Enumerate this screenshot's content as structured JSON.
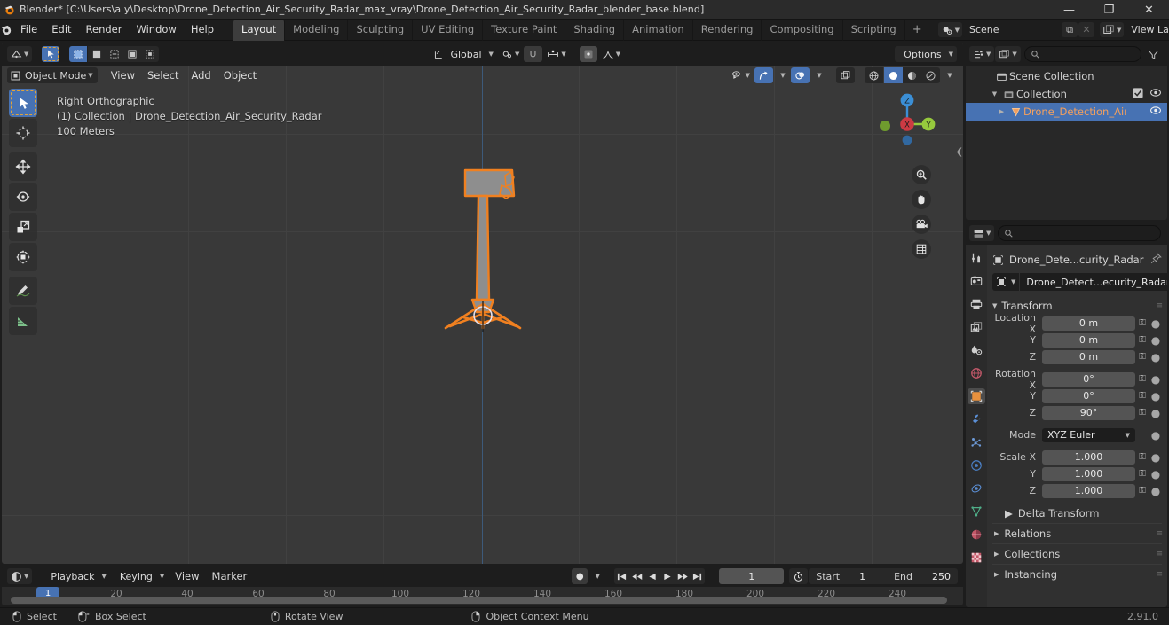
{
  "titlebar": {
    "title": "Blender* [C:\\Users\\a y\\Desktop\\Drone_Detection_Air_Security_Radar_max_vray\\Drone_Detection_Air_Security_Radar_blender_base.blend]",
    "minimize": "—",
    "maximize": "❐",
    "close": "✕"
  },
  "menubar": {
    "items": [
      "File",
      "Edit",
      "Render",
      "Window",
      "Help"
    ]
  },
  "workspace_tabs": [
    {
      "label": "Layout",
      "active": true
    },
    {
      "label": "Modeling",
      "active": false
    },
    {
      "label": "Sculpting",
      "active": false
    },
    {
      "label": "UV Editing",
      "active": false
    },
    {
      "label": "Texture Paint",
      "active": false
    },
    {
      "label": "Shading",
      "active": false
    },
    {
      "label": "Animation",
      "active": false
    },
    {
      "label": "Rendering",
      "active": false
    },
    {
      "label": "Compositing",
      "active": false
    },
    {
      "label": "Scripting",
      "active": false
    }
  ],
  "workspace_add": "+",
  "scene_selector": {
    "scene_label": "Scene",
    "view_layer_label": "View Layer",
    "copy_glyph": "⧉",
    "x_glyph": "✕"
  },
  "viewport": {
    "header": {
      "editor_type_icon": "editor-type-icon",
      "mode": "Object Mode",
      "menus": [
        "View",
        "Select",
        "Add",
        "Object"
      ],
      "transform_orientation": "Global",
      "options_label": "Options",
      "select_modes": [
        "tweak",
        "box",
        "circle",
        "lasso"
      ]
    },
    "overlay_text": {
      "line1": "Right Orthographic",
      "line2": "(1) Collection | Drone_Detection_Air_Security_Radar",
      "line3": "100 Meters"
    },
    "gizmo": {
      "x": "X",
      "y": "Y",
      "z": "Z",
      "x_color": "#cc3a43",
      "y_color": "#96c93d",
      "z_color": "#3b8fd6"
    },
    "nav_buttons": [
      "zoom-icon",
      "hand-icon",
      "camera-icon",
      "grid-icon"
    ],
    "tools": [
      {
        "name": "tweak-select-tool",
        "active": true
      },
      {
        "name": "cursor-tool",
        "active": false
      },
      {
        "name": "move-tool",
        "active": false
      },
      {
        "name": "rotate-tool",
        "active": false
      },
      {
        "name": "scale-tool",
        "active": false
      },
      {
        "name": "transform-tool",
        "active": false
      },
      {
        "name": "annotate-tool",
        "active": false
      },
      {
        "name": "measure-tool",
        "active": false
      }
    ]
  },
  "timeline": {
    "editor_icon": "timeline-editor-icon",
    "menus": [
      "Playback",
      "Keying",
      "View",
      "Marker"
    ],
    "record_icon": "●",
    "transport": [
      "jump-start",
      "prev-keyframe",
      "play-reverse",
      "play",
      "next-keyframe",
      "jump-end"
    ],
    "current_frame": "1",
    "start_label": "Start",
    "start_value": "1",
    "end_label": "End",
    "end_value": "250",
    "ticks": [
      20,
      40,
      60,
      80,
      100,
      120,
      140,
      160,
      180,
      200,
      220,
      240
    ],
    "playhead_frame": "1"
  },
  "outliner": {
    "display_mode_icon": "outliner-display-mode-icon",
    "filter_icon": "filter-icon",
    "search_placeholder": "",
    "rows": [
      {
        "label": "Scene Collection",
        "indent": 0,
        "icon": "scene-collection-icon",
        "disclosure": "",
        "checkbox": false,
        "eye": false,
        "selected": false
      },
      {
        "label": "Collection",
        "indent": 1,
        "icon": "collection-icon",
        "disclosure": "▼",
        "checkbox": true,
        "eye": true,
        "selected": false
      },
      {
        "label": "Drone_Detection_Aiı",
        "indent": 2,
        "icon": "mesh-object-icon",
        "disclosure": "▶",
        "checkbox": false,
        "eye": true,
        "selected": true
      }
    ]
  },
  "properties": {
    "search_placeholder": "",
    "tabs": [
      {
        "name": "tool-tab",
        "active": false
      },
      {
        "name": "render-tab",
        "active": false
      },
      {
        "name": "output-tab",
        "active": false
      },
      {
        "name": "view-layer-tab",
        "active": false
      },
      {
        "name": "scene-tab",
        "active": false
      },
      {
        "name": "world-tab",
        "active": false
      },
      {
        "name": "object-tab",
        "active": true
      },
      {
        "name": "modifier-tab",
        "active": false
      },
      {
        "name": "particles-tab",
        "active": false
      },
      {
        "name": "physics-tab",
        "active": false
      },
      {
        "name": "constraints-tab",
        "active": false
      },
      {
        "name": "object-data-tab",
        "active": false
      },
      {
        "name": "material-tab",
        "active": false
      },
      {
        "name": "texture-tab",
        "active": false
      }
    ],
    "breadcrumb": "Drone_Dete...curity_Radar",
    "object_name": "Drone_Detect...ecurity_Radar",
    "transform_panel": "Transform",
    "fields": [
      {
        "label": "Location X",
        "value": "0 m"
      },
      {
        "label": "Y",
        "value": "0 m"
      },
      {
        "label": "Z",
        "value": "0 m"
      },
      {
        "label": "Rotation X",
        "value": "0°"
      },
      {
        "label": "Y",
        "value": "0°"
      },
      {
        "label": "Z",
        "value": "90°"
      },
      {
        "label": "Mode",
        "value": "XYZ Euler"
      },
      {
        "label": "Scale X",
        "value": "1.000"
      },
      {
        "label": "Y",
        "value": "1.000"
      },
      {
        "label": "Z",
        "value": "1.000"
      }
    ],
    "delta_transform": "Delta Transform",
    "collapsed_panels": [
      "Relations",
      "Collections",
      "Instancing"
    ]
  },
  "statusbar": {
    "items": [
      "Select",
      "Box Select",
      "Rotate View",
      "Object Context Menu"
    ],
    "version": "2.91.0"
  }
}
